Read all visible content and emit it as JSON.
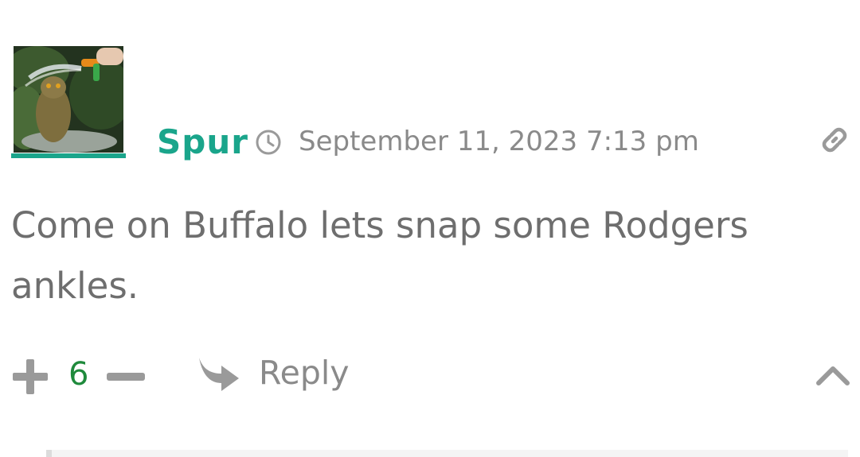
{
  "comment": {
    "author": "Spur",
    "timestamp": "September 11, 2023 7:13 pm",
    "body": "Come on Buffalo lets snap some Rodgers ankles.",
    "votes": "6",
    "reply_label": "Reply"
  },
  "icons": {
    "avatar": "owl-being-hosed-photo",
    "time": "clock-icon",
    "permalink": "link-icon",
    "upvote": "plus-icon",
    "downvote": "minus-icon",
    "reply": "reply-arrow-icon",
    "collapse": "chevron-up-icon"
  },
  "colors": {
    "accent": "#1aa58b",
    "vote_count": "#1f8a3c",
    "muted_text": "#8a8a8a",
    "body_text": "#6e6e6e"
  }
}
